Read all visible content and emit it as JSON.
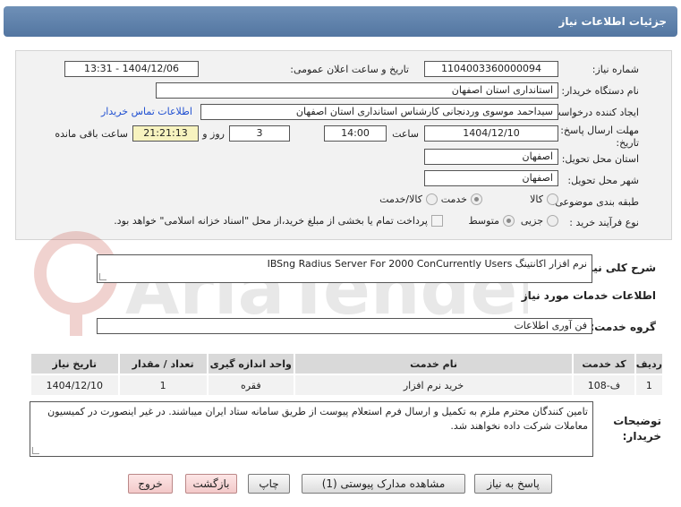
{
  "header": {
    "title": "جزئیات اطلاعات نیاز"
  },
  "form": {
    "need_number_label": "شماره نیاز:",
    "need_number": "1104003360000094",
    "announce_label": "تاریخ و ساعت اعلان عمومی:",
    "announce_value": "1404/12/06 - 13:31",
    "buyer_org_label": "نام دستگاه خریدار:",
    "buyer_org": "استانداری استان اصفهان",
    "creator_label": "ایجاد کننده درخواست:",
    "creator": "سیداحمد موسوی وردنجانی کارشناس استانداری استان اصفهان",
    "contact_link": "اطلاعات تماس خریدار",
    "deadline_label_1": "مهلت ارسال پاسخ: تا",
    "deadline_label_2": "تاریخ:",
    "deadline_date": "1404/12/10",
    "time_label": "ساعت",
    "deadline_time": "14:00",
    "days_value": "3",
    "days_label": "روز و",
    "remaining_time": "21:21:13",
    "remaining_label": "ساعت باقی مانده",
    "province_label": "استان محل تحویل:",
    "province": "اصفهان",
    "city_label": "شهر محل تحویل:",
    "city": "اصفهان",
    "category_label": "طبقه بندی موضوعی:",
    "category_options": [
      "کالا",
      "خدمت",
      "کالا/خدمت"
    ],
    "category_selected": 1,
    "process_label": "نوع فرآیند خرید :",
    "process_options": [
      "جزیی",
      "متوسط"
    ],
    "process_selected": 1,
    "treasury_text": "پرداخت تمام یا بخشی از مبلغ خرید،از محل \"اسناد خزانه اسلامی\" خواهد بود."
  },
  "summary": {
    "label": "شرح کلی نیاز:",
    "value": "نرم افزار اکانتینگ IBSng Radius Server For 2000 ConCurrently Users"
  },
  "services": {
    "section_title": "اطلاعات خدمات مورد نیاز",
    "group_label": "گروه خدمت:",
    "group_value": "فن آوری اطلاعات",
    "columns": [
      "ردیف",
      "کد خدمت",
      "نام خدمت",
      "واحد اندازه گیری",
      "تعداد / مقدار",
      "تاریخ نیاز"
    ],
    "rows": [
      [
        "1",
        "ف-108",
        "خرید نرم افزار",
        "فقره",
        "1",
        "1404/12/10"
      ]
    ]
  },
  "notes": {
    "label_1": "توضیحات",
    "label_2": "خریدار:",
    "text": "تامین کنندگان محترم ملزم به تکمیل و ارسال فرم استعلام پیوست از طریق سامانه ستاد ایران میباشند. در غیر اینصورت در کمیسیون معاملات شرکت داده نخواهند شد."
  },
  "buttons": {
    "reply": "پاسخ به نیاز",
    "attachments": "مشاهده مدارک پیوستی (1)",
    "print": "چاپ",
    "back": "بازگشت",
    "exit": "خروج"
  },
  "colors": {
    "header_bg": "#5f82ad",
    "time_highlight": "#f7f3bf",
    "link": "#1f4fd1",
    "watermark": "#c0392b"
  }
}
